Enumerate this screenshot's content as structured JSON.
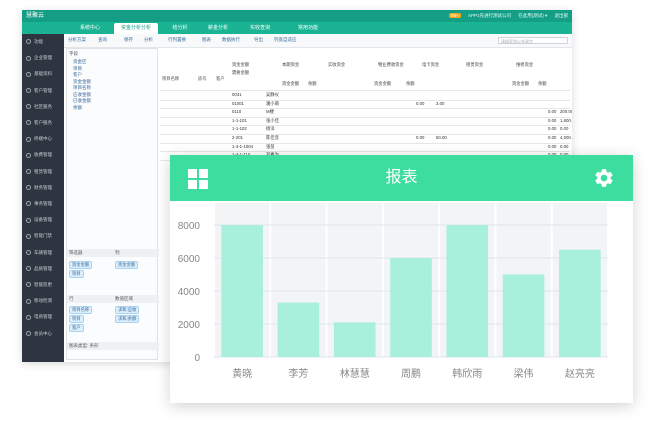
{
  "app": {
    "logo": "慧聚云",
    "topright": {
      "badge": "99+",
      "company": "APP1先进行测试公司",
      "user": "在此用(测试) ▾",
      "logout": "退出部"
    },
    "tabs": [
      {
        "label": "系统中心",
        "active": false
      },
      {
        "label": "资金分析分析",
        "active": true
      },
      {
        "label": "结分析",
        "active": false
      },
      {
        "label": "薪金分析",
        "active": false
      },
      {
        "label": "实收查询",
        "active": false
      },
      {
        "label": "常用功能",
        "active": false
      }
    ],
    "sidebar": [
      "功能",
      "企业管理",
      "基础资料",
      "客户管理",
      "社区服务",
      "客户服务",
      "终端中心",
      "收费管理",
      "租赁管理",
      "财务管理",
      "事务管理",
      "设备管理",
      "智能门禁",
      "车辆管理",
      "品质管理",
      "智能巡更",
      "移动检测",
      "电商管理",
      "会员中心"
    ],
    "toolbar": [
      "分析方案",
      "查询",
      "保存",
      "分析",
      "行列置换",
      "图表",
      "数据执行",
      "导出",
      "列宽自适应"
    ],
    "search_placeholder": "请搜索到以关键字",
    "fields_title": "字段",
    "fields": [
      "资金区",
      "项目",
      "客户",
      "资金金额",
      "项目名称",
      "应收金额",
      "已收金额",
      "余额"
    ],
    "sections": {
      "filter": "筛选器",
      "column": "列",
      "row": "行",
      "value": "数值区域",
      "chart_type": "图表类型: 条形"
    },
    "filter_chips": [
      "资金金额",
      "项目"
    ],
    "column_chips": [
      "资金金额"
    ],
    "row_chips": [
      "项目名称",
      "项目",
      "客户"
    ],
    "value_chips": [
      "求和:应收",
      "求和:余额"
    ],
    "grid_headers": [
      "项目名称",
      "房号",
      "客户",
      "资金金额",
      "需要金额",
      "本期资金",
      "实收资金",
      "物业费收资金",
      "电卡资金",
      "租赁资金",
      "维修资金"
    ],
    "grid_subheaders": [
      "资金金额",
      "余额",
      "资金金额",
      "余额",
      "资金金额",
      "余额"
    ],
    "grid_rows": [
      {
        "code": "0041",
        "name": "吴静仪",
        "v1": "",
        "v2": "",
        "v3": "",
        "v4": ""
      },
      {
        "code": "01001",
        "name": "潘小萌",
        "v1": "0.00",
        "v2": "3.00",
        "v3": "",
        "v4": ""
      },
      {
        "code": "0110",
        "name": "M楼",
        "v1": "",
        "v2": "",
        "v3": "0.00",
        "v4": "200.00"
      },
      {
        "code": "1-1-101",
        "name": "张小佳",
        "v1": "",
        "v2": "",
        "v3": "0.00",
        "v4": "1,600.00"
      },
      {
        "code": "1-1-102",
        "name": "杨洋",
        "v1": "",
        "v2": "",
        "v3": "0.00",
        "v4": "0.00"
      },
      {
        "code": "2-201",
        "name": "陈佳音",
        "v1": "0.00",
        "v2": "50.00",
        "v3": "0.00",
        "v4": "4,000.00"
      },
      {
        "code": "1-4-1-1004",
        "name": "张苗",
        "v1": "",
        "v2": "",
        "v3": "0.00",
        "v4": "0.00"
      },
      {
        "code": "1-4-1-110",
        "name": "刘嘉为",
        "v1": "",
        "v2": "",
        "v3": "0.00",
        "v4": "0.00"
      }
    ]
  },
  "report": {
    "title": "报表",
    "left_icon": "grid-icon",
    "right_icon": "gear-icon",
    "header_color": "#3ddc9f",
    "bar_color": "#a8f0dc"
  },
  "chart_data": {
    "type": "bar",
    "title": "",
    "xlabel": "",
    "ylabel": "",
    "categories": [
      "黄晓",
      "李芳",
      "林慧慧",
      "周鹏",
      "韩欣雨",
      "梁伟",
      "赵亮亮"
    ],
    "values": [
      8000,
      3300,
      2100,
      6000,
      8000,
      5000,
      6500
    ],
    "ylim": [
      0,
      8000
    ],
    "yticks": [
      0,
      2000,
      4000,
      6000,
      8000
    ],
    "grid": true
  }
}
